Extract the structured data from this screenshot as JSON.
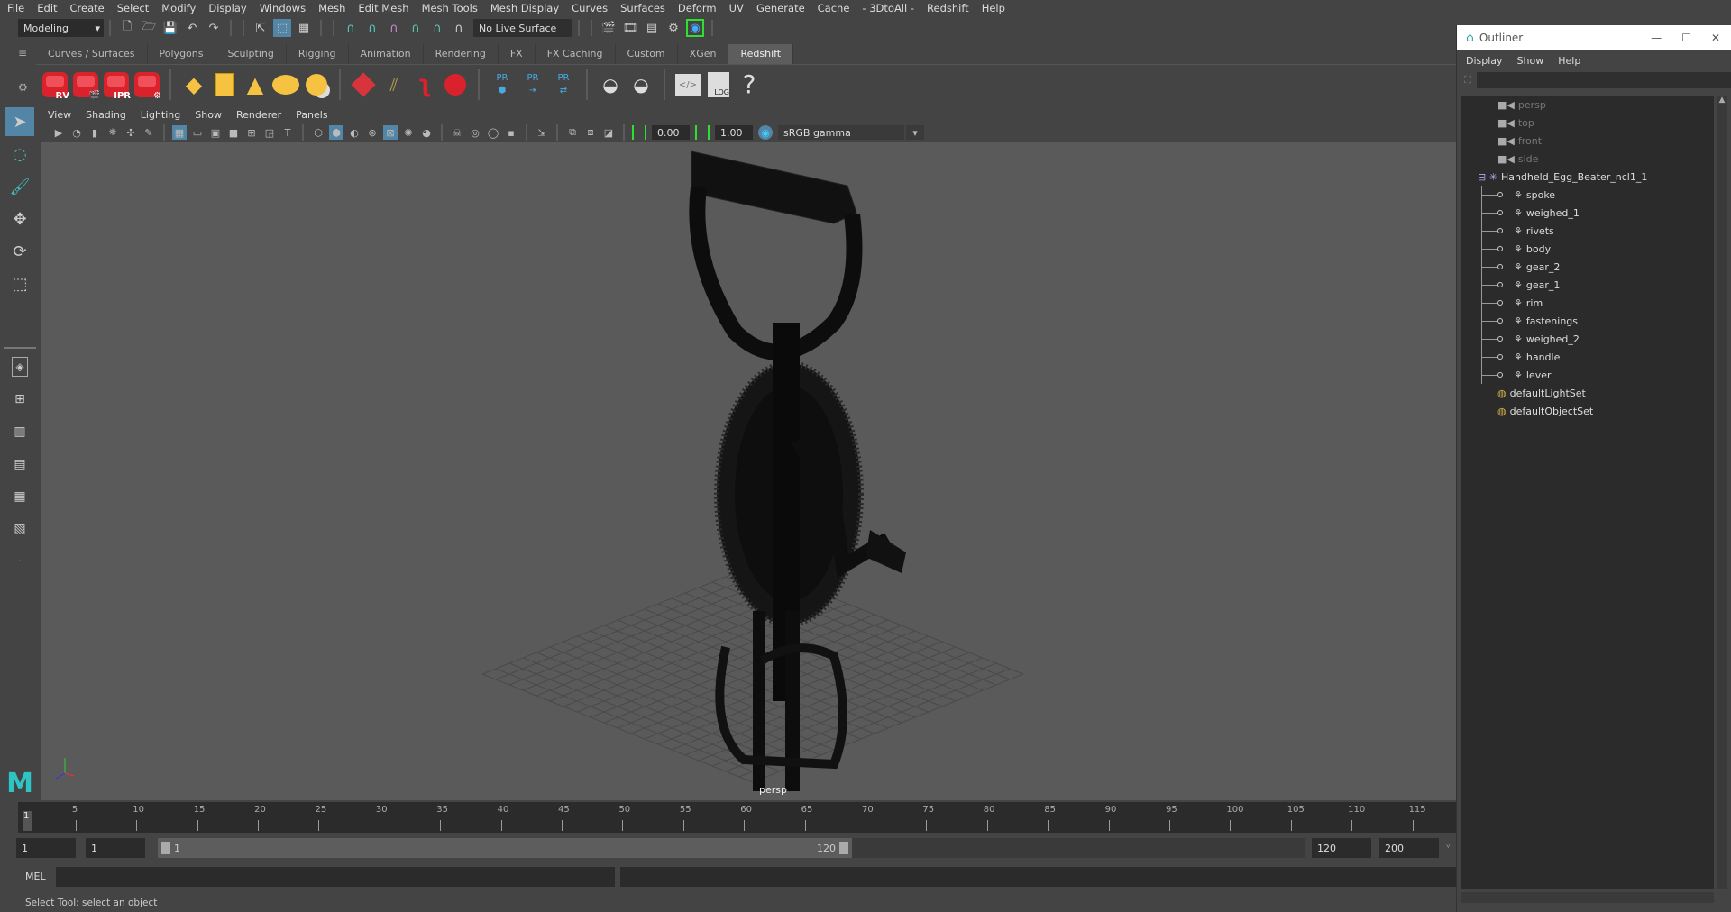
{
  "menubar": [
    "File",
    "Edit",
    "Create",
    "Select",
    "Modify",
    "Display",
    "Windows",
    "Mesh",
    "Edit Mesh",
    "Mesh Tools",
    "Mesh Display",
    "Curves",
    "Surfaces",
    "Deform",
    "UV",
    "Generate",
    "Cache",
    "- 3DtoAll -",
    "Redshift",
    "Help"
  ],
  "status_line": {
    "mode_dropdown": "Modeling",
    "live_surface": "No Live Surface"
  },
  "shelf": {
    "tabs": [
      "Curves / Surfaces",
      "Polygons",
      "Sculpting",
      "Rigging",
      "Animation",
      "Rendering",
      "FX",
      "FX Caching",
      "Custom",
      "XGen",
      "Redshift"
    ],
    "active_tab": "Redshift",
    "redshift_icons": [
      "RV",
      "",
      "IPR",
      ""
    ],
    "pr_labels": [
      "PR",
      "PR",
      "PR"
    ],
    "log_label": "LOG",
    "help_label": "?"
  },
  "panel": {
    "menu": [
      "View",
      "Shading",
      "Lighting",
      "Show",
      "Renderer",
      "Panels"
    ],
    "exposure": "0.00",
    "gamma": "1.00",
    "color_space": "sRGB gamma"
  },
  "viewport": {
    "camera_label": "persp"
  },
  "timeline": {
    "ticks": [
      "5",
      "10",
      "15",
      "20",
      "25",
      "30",
      "35",
      "40",
      "45",
      "50",
      "55",
      "60",
      "65",
      "70",
      "75",
      "80",
      "85",
      "90",
      "95",
      "100",
      "105",
      "110",
      "115"
    ],
    "current_frame": "1"
  },
  "range": {
    "start": "1",
    "playback_start": "1",
    "slider_start": "1",
    "slider_end": "120",
    "playback_end": "120",
    "end": "200"
  },
  "mel": {
    "label": "MEL"
  },
  "status": "Select Tool: select an object",
  "outliner": {
    "title": "Outliner",
    "menu": [
      "Display",
      "Show",
      "Help"
    ],
    "cameras": [
      "persp",
      "top",
      "front",
      "side"
    ],
    "group": "Handheld_Egg_Beater_ncl1_1",
    "children": [
      "spoke",
      "weighed_1",
      "rivets",
      "body",
      "gear_2",
      "gear_1",
      "rim",
      "fastenings",
      "weighed_2",
      "handle",
      "lever"
    ],
    "sets": [
      "defaultLightSet",
      "defaultObjectSet"
    ]
  }
}
